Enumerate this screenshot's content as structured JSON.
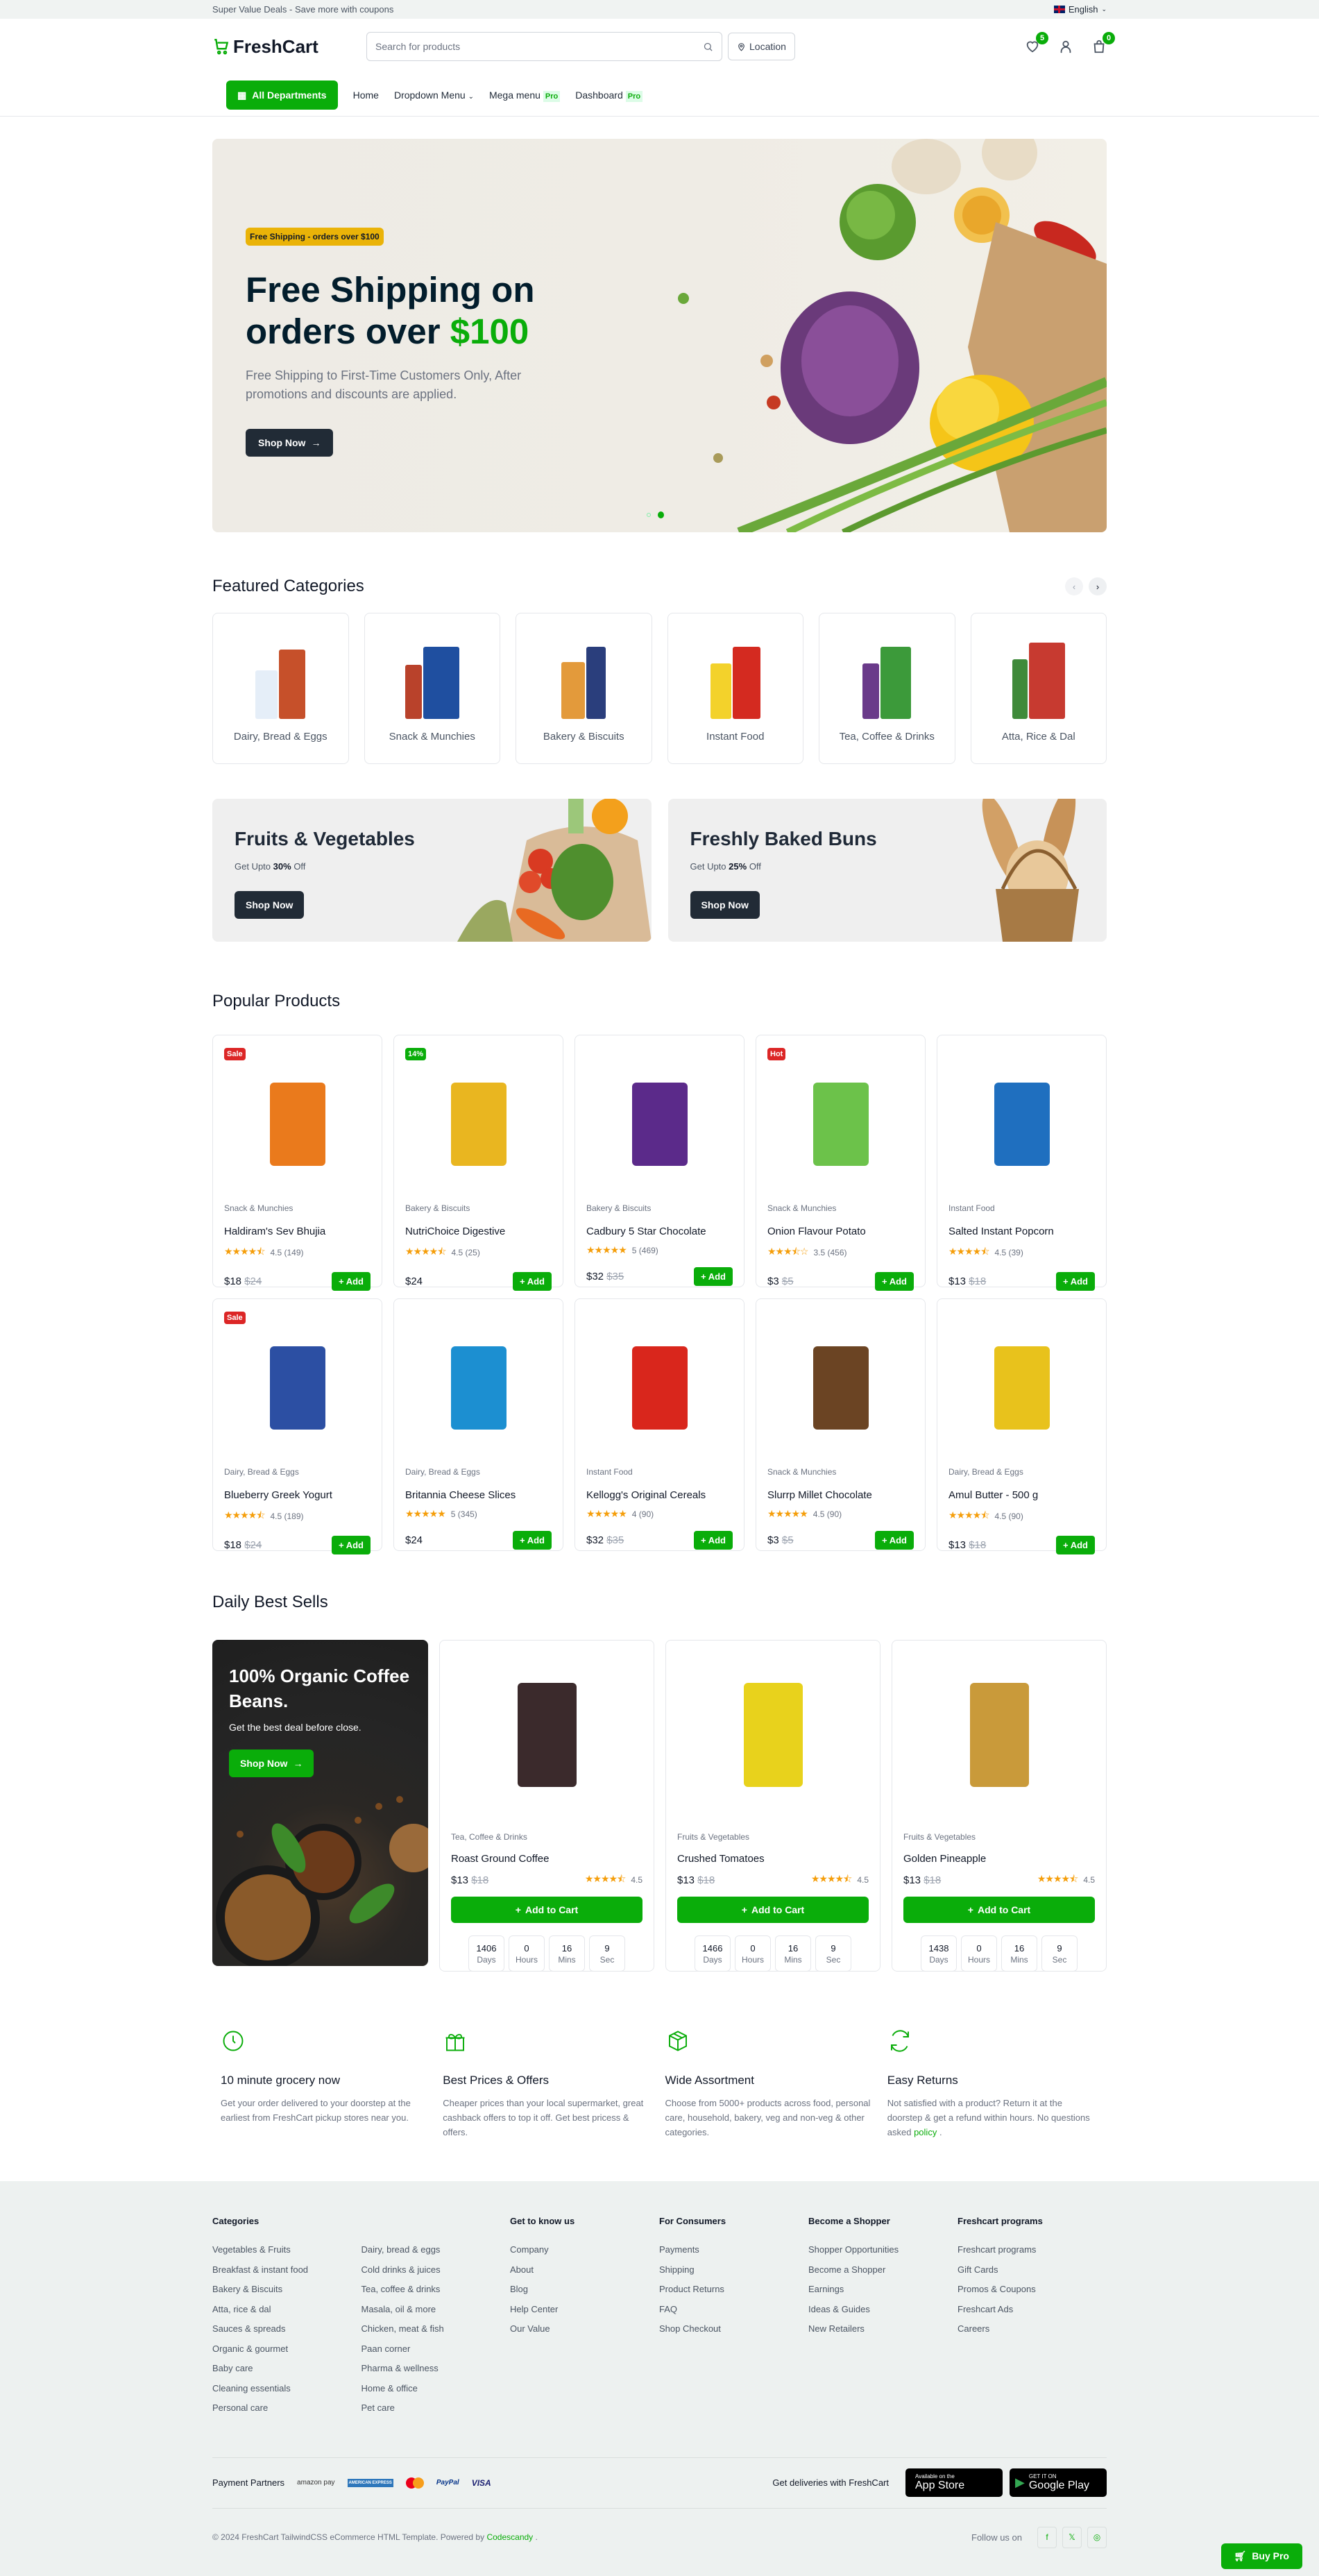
{
  "topbar": {
    "promo": "Super Value Deals - Save more with coupons",
    "language": "English"
  },
  "header": {
    "brand": "FreshCart",
    "search_placeholder": "Search for products",
    "location_label": "Location",
    "wishlist_count": "5",
    "cart_count": "0"
  },
  "nav": {
    "all_departments": "All Departments",
    "items": [
      {
        "label": "Home"
      },
      {
        "label": "Dropdown Menu"
      },
      {
        "label": "Mega menu",
        "badge": "Pro"
      },
      {
        "label": "Dashboard",
        "badge": "Pro"
      }
    ]
  },
  "hero": {
    "tag": "Free Shipping - orders over $100",
    "title_main": "Free Shipping on orders over",
    "title_accent": "$100",
    "description": "Free Shipping to First-Time Customers Only, After promotions and discounts are applied.",
    "cta": "Shop Now",
    "slides": 2,
    "active_slide": 2
  },
  "featured": {
    "title": "Featured Categories",
    "categories": [
      {
        "label": "Dairy, Bread & Eggs"
      },
      {
        "label": "Snack & Munchies"
      },
      {
        "label": "Bakery & Biscuits"
      },
      {
        "label": "Instant Food"
      },
      {
        "label": "Tea, Coffee & Drinks"
      },
      {
        "label": "Atta, Rice & Dal"
      }
    ]
  },
  "promo_banners": [
    {
      "title": "Fruits & Vegetables",
      "sub_prefix": "Get Upto",
      "discount": "30%",
      "sub_suffix": "Off",
      "cta": "Shop Now"
    },
    {
      "title": "Freshly Baked Buns",
      "sub_prefix": "Get Upto",
      "discount": "25%",
      "sub_suffix": "Off",
      "cta": "Shop Now"
    }
  ],
  "popular": {
    "title": "Popular Products",
    "add_label": "+ Add",
    "products": [
      {
        "badge": "Sale",
        "badge_color": "#dc2626",
        "category": "Snack & Munchies",
        "name": "Haldiram's Sev Bhujia",
        "stars": "★★★★⯪",
        "rating": "4.5 (149)",
        "price": "$18",
        "old_price": "$24",
        "color": "#ea7a1c"
      },
      {
        "badge": "14%",
        "badge_color": "#0aad0a",
        "category": "Bakery & Biscuits",
        "name": "NutriChoice Digestive",
        "stars": "★★★★⯪",
        "rating": "4.5 (25)",
        "price": "$24",
        "old_price": "",
        "color": "#e9b620"
      },
      {
        "badge": "",
        "badge_color": "",
        "category": "Bakery & Biscuits",
        "name": "Cadbury 5 Star Chocolate",
        "stars": "★★★★★",
        "rating": "5 (469)",
        "price": "$32",
        "old_price": "$35",
        "color": "#5b2a8a"
      },
      {
        "badge": "Hot",
        "badge_color": "#dc2626",
        "category": "Snack & Munchies",
        "name": "Onion Flavour Potato",
        "stars": "★★★⯪☆",
        "rating": "3.5 (456)",
        "price": "$3",
        "old_price": "$5",
        "color": "#6cc24a"
      },
      {
        "badge": "",
        "badge_color": "",
        "category": "Instant Food",
        "name": "Salted Instant Popcorn",
        "stars": "★★★★⯪",
        "rating": "4.5 (39)",
        "price": "$13",
        "old_price": "$18",
        "color": "#1f6fbf"
      },
      {
        "badge": "Sale",
        "badge_color": "#dc2626",
        "category": "Dairy, Bread & Eggs",
        "name": "Blueberry Greek Yogurt",
        "stars": "★★★★⯪",
        "rating": "4.5 (189)",
        "price": "$18",
        "old_price": "$24",
        "color": "#2c4fa3"
      },
      {
        "badge": "",
        "badge_color": "",
        "category": "Dairy, Bread & Eggs",
        "name": "Britannia Cheese Slices",
        "stars": "★★★★★",
        "rating": "5 (345)",
        "price": "$24",
        "old_price": "",
        "color": "#1c8fd1"
      },
      {
        "badge": "",
        "badge_color": "",
        "category": "Instant Food",
        "name": "Kellogg's Original Cereals",
        "stars": "★★★★★",
        "rating": "4 (90)",
        "price": "$32",
        "old_price": "$35",
        "color": "#d9261c"
      },
      {
        "badge": "",
        "badge_color": "",
        "category": "Snack & Munchies",
        "name": "Slurrp Millet Chocolate",
        "stars": "★★★★★",
        "rating": "4.5 (90)",
        "price": "$3",
        "old_price": "$5",
        "color": "#6b4423"
      },
      {
        "badge": "",
        "badge_color": "",
        "category": "Dairy, Bread & Eggs",
        "name": "Amul Butter - 500 g",
        "stars": "★★★★⯪",
        "rating": "4.5 (90)",
        "price": "$13",
        "old_price": "$18",
        "color": "#e8c21c"
      }
    ]
  },
  "daily": {
    "title": "Daily Best Sells",
    "promo": {
      "title": "100% Organic Coffee Beans.",
      "subtitle": "Get the best deal before close.",
      "cta": "Shop Now"
    },
    "add_to_cart": "Add to Cart",
    "timer_labels": {
      "days": "Days",
      "hours": "Hours",
      "mins": "Mins",
      "sec": "Sec"
    },
    "products": [
      {
        "category": "Tea, Coffee & Drinks",
        "name": "Roast Ground Coffee",
        "price": "$13",
        "old_price": "$18",
        "stars": "★★★★⯪",
        "rating": "4.5",
        "days": "1406",
        "hours": "0",
        "mins": "16",
        "sec": "9",
        "color": "#3b2a2c"
      },
      {
        "category": "Fruits & Vegetables",
        "name": "Crushed Tomatoes",
        "price": "$13",
        "old_price": "$18",
        "stars": "★★★★⯪",
        "rating": "4.5",
        "days": "1466",
        "hours": "0",
        "mins": "16",
        "sec": "9",
        "color": "#e8d21c"
      },
      {
        "category": "Fruits & Vegetables",
        "name": "Golden Pineapple",
        "price": "$13",
        "old_price": "$18",
        "stars": "★★★★⯪",
        "rating": "4.5",
        "days": "1438",
        "hours": "0",
        "mins": "16",
        "sec": "9",
        "color": "#c99a3a"
      }
    ]
  },
  "features": [
    {
      "icon": "clock-icon",
      "title": "10 minute grocery now",
      "text": "Get your order delivered to your doorstep at the earliest from FreshCart pickup stores near you."
    },
    {
      "icon": "gift-icon",
      "title": "Best Prices & Offers",
      "text": "Cheaper prices than your local supermarket, great cashback offers to top it off. Get best pricess & offers."
    },
    {
      "icon": "box-icon",
      "title": "Wide Assortment",
      "text": "Choose from 5000+ products across food, personal care, household, bakery, veg and non-veg & other categories."
    },
    {
      "icon": "refresh-icon",
      "title": "Easy Returns",
      "text": "Not satisfied with a product? Return it at the doorstep & get a refund within hours. No questions asked",
      "link": "policy"
    }
  ],
  "footer": {
    "categories_title": "Categories",
    "categories_col1": [
      "Vegetables & Fruits",
      "Breakfast & instant food",
      "Bakery & Biscuits",
      "Atta, rice & dal",
      "Sauces & spreads",
      "Organic & gourmet",
      "Baby care",
      "Cleaning essentials",
      "Personal care"
    ],
    "categories_col2": [
      "Dairy, bread & eggs",
      "Cold drinks & juices",
      "Tea, coffee & drinks",
      "Masala, oil & more",
      "Chicken, meat & fish",
      "Paan corner",
      "Pharma & wellness",
      "Home & office",
      "Pet care"
    ],
    "columns": [
      {
        "title": "Get to know us",
        "links": [
          "Company",
          "About",
          "Blog",
          "Help Center",
          "Our Value"
        ]
      },
      {
        "title": "For Consumers",
        "links": [
          "Payments",
          "Shipping",
          "Product Returns",
          "FAQ",
          "Shop Checkout"
        ]
      },
      {
        "title": "Become a Shopper",
        "links": [
          "Shopper Opportunities",
          "Become a Shopper",
          "Earnings",
          "Ideas & Guides",
          "New Retailers"
        ]
      },
      {
        "title": "Freshcart programs",
        "links": [
          "Freshcart programs",
          "Gift Cards",
          "Promos & Coupons",
          "Freshcart Ads",
          "Careers"
        ]
      }
    ],
    "payment_label": "Payment Partners",
    "payment_partners": [
      "amazon pay",
      "AMERICAN EXPRESS",
      "MasterCard",
      "PayPal",
      "VISA"
    ],
    "deliveries_label": "Get deliveries with FreshCart",
    "app_store": {
      "small": "Available on the",
      "big": "App Store"
    },
    "google_play": {
      "small": "GET IT ON",
      "big": "Google Play"
    },
    "copyright": "© 2024 FreshCart TailwindCSS eCommerce HTML Template. Powered by",
    "powered_by": "Codescandy",
    "follow_label": "Follow us on",
    "buy_pro": "Buy Pro"
  }
}
